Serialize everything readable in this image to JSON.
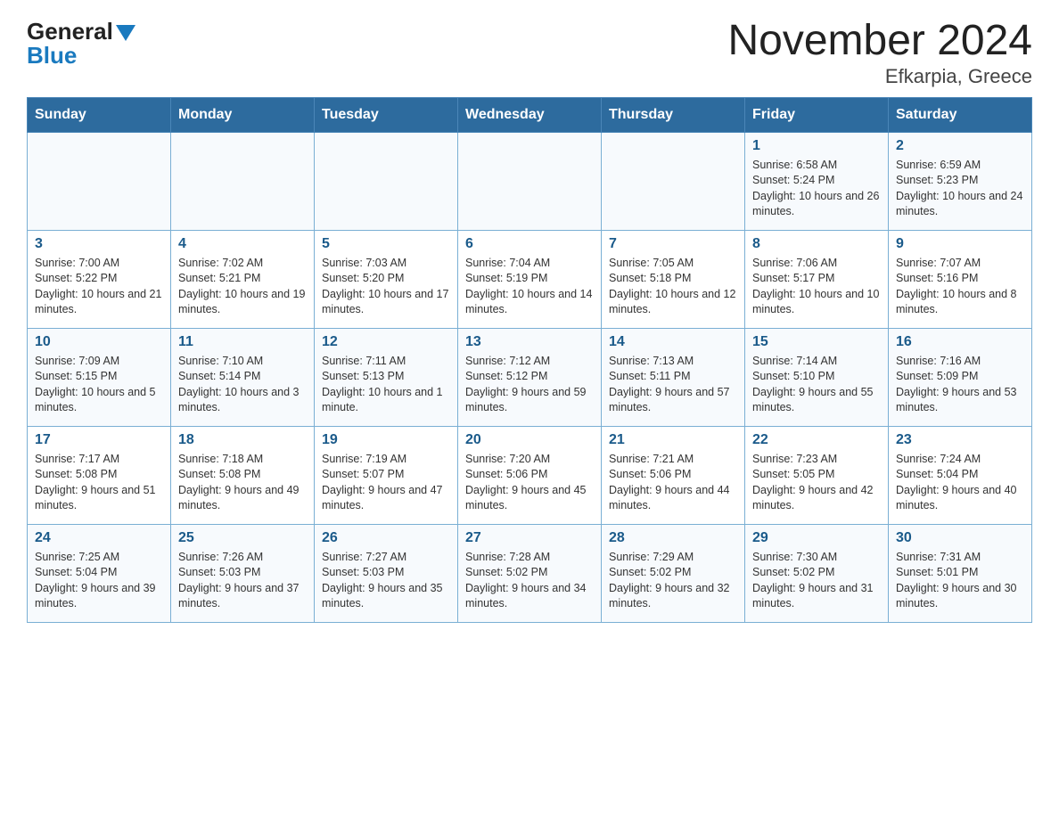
{
  "header": {
    "logo_line1": "General",
    "logo_line2": "Blue",
    "title": "November 2024",
    "subtitle": "Efkarpia, Greece"
  },
  "days": [
    "Sunday",
    "Monday",
    "Tuesday",
    "Wednesday",
    "Thursday",
    "Friday",
    "Saturday"
  ],
  "rows": [
    [
      {
        "day": "",
        "sunrise": "",
        "sunset": "",
        "daylight": ""
      },
      {
        "day": "",
        "sunrise": "",
        "sunset": "",
        "daylight": ""
      },
      {
        "day": "",
        "sunrise": "",
        "sunset": "",
        "daylight": ""
      },
      {
        "day": "",
        "sunrise": "",
        "sunset": "",
        "daylight": ""
      },
      {
        "day": "",
        "sunrise": "",
        "sunset": "",
        "daylight": ""
      },
      {
        "day": "1",
        "sunrise": "Sunrise: 6:58 AM",
        "sunset": "Sunset: 5:24 PM",
        "daylight": "Daylight: 10 hours and 26 minutes."
      },
      {
        "day": "2",
        "sunrise": "Sunrise: 6:59 AM",
        "sunset": "Sunset: 5:23 PM",
        "daylight": "Daylight: 10 hours and 24 minutes."
      }
    ],
    [
      {
        "day": "3",
        "sunrise": "Sunrise: 7:00 AM",
        "sunset": "Sunset: 5:22 PM",
        "daylight": "Daylight: 10 hours and 21 minutes."
      },
      {
        "day": "4",
        "sunrise": "Sunrise: 7:02 AM",
        "sunset": "Sunset: 5:21 PM",
        "daylight": "Daylight: 10 hours and 19 minutes."
      },
      {
        "day": "5",
        "sunrise": "Sunrise: 7:03 AM",
        "sunset": "Sunset: 5:20 PM",
        "daylight": "Daylight: 10 hours and 17 minutes."
      },
      {
        "day": "6",
        "sunrise": "Sunrise: 7:04 AM",
        "sunset": "Sunset: 5:19 PM",
        "daylight": "Daylight: 10 hours and 14 minutes."
      },
      {
        "day": "7",
        "sunrise": "Sunrise: 7:05 AM",
        "sunset": "Sunset: 5:18 PM",
        "daylight": "Daylight: 10 hours and 12 minutes."
      },
      {
        "day": "8",
        "sunrise": "Sunrise: 7:06 AM",
        "sunset": "Sunset: 5:17 PM",
        "daylight": "Daylight: 10 hours and 10 minutes."
      },
      {
        "day": "9",
        "sunrise": "Sunrise: 7:07 AM",
        "sunset": "Sunset: 5:16 PM",
        "daylight": "Daylight: 10 hours and 8 minutes."
      }
    ],
    [
      {
        "day": "10",
        "sunrise": "Sunrise: 7:09 AM",
        "sunset": "Sunset: 5:15 PM",
        "daylight": "Daylight: 10 hours and 5 minutes."
      },
      {
        "day": "11",
        "sunrise": "Sunrise: 7:10 AM",
        "sunset": "Sunset: 5:14 PM",
        "daylight": "Daylight: 10 hours and 3 minutes."
      },
      {
        "day": "12",
        "sunrise": "Sunrise: 7:11 AM",
        "sunset": "Sunset: 5:13 PM",
        "daylight": "Daylight: 10 hours and 1 minute."
      },
      {
        "day": "13",
        "sunrise": "Sunrise: 7:12 AM",
        "sunset": "Sunset: 5:12 PM",
        "daylight": "Daylight: 9 hours and 59 minutes."
      },
      {
        "day": "14",
        "sunrise": "Sunrise: 7:13 AM",
        "sunset": "Sunset: 5:11 PM",
        "daylight": "Daylight: 9 hours and 57 minutes."
      },
      {
        "day": "15",
        "sunrise": "Sunrise: 7:14 AM",
        "sunset": "Sunset: 5:10 PM",
        "daylight": "Daylight: 9 hours and 55 minutes."
      },
      {
        "day": "16",
        "sunrise": "Sunrise: 7:16 AM",
        "sunset": "Sunset: 5:09 PM",
        "daylight": "Daylight: 9 hours and 53 minutes."
      }
    ],
    [
      {
        "day": "17",
        "sunrise": "Sunrise: 7:17 AM",
        "sunset": "Sunset: 5:08 PM",
        "daylight": "Daylight: 9 hours and 51 minutes."
      },
      {
        "day": "18",
        "sunrise": "Sunrise: 7:18 AM",
        "sunset": "Sunset: 5:08 PM",
        "daylight": "Daylight: 9 hours and 49 minutes."
      },
      {
        "day": "19",
        "sunrise": "Sunrise: 7:19 AM",
        "sunset": "Sunset: 5:07 PM",
        "daylight": "Daylight: 9 hours and 47 minutes."
      },
      {
        "day": "20",
        "sunrise": "Sunrise: 7:20 AM",
        "sunset": "Sunset: 5:06 PM",
        "daylight": "Daylight: 9 hours and 45 minutes."
      },
      {
        "day": "21",
        "sunrise": "Sunrise: 7:21 AM",
        "sunset": "Sunset: 5:06 PM",
        "daylight": "Daylight: 9 hours and 44 minutes."
      },
      {
        "day": "22",
        "sunrise": "Sunrise: 7:23 AM",
        "sunset": "Sunset: 5:05 PM",
        "daylight": "Daylight: 9 hours and 42 minutes."
      },
      {
        "day": "23",
        "sunrise": "Sunrise: 7:24 AM",
        "sunset": "Sunset: 5:04 PM",
        "daylight": "Daylight: 9 hours and 40 minutes."
      }
    ],
    [
      {
        "day": "24",
        "sunrise": "Sunrise: 7:25 AM",
        "sunset": "Sunset: 5:04 PM",
        "daylight": "Daylight: 9 hours and 39 minutes."
      },
      {
        "day": "25",
        "sunrise": "Sunrise: 7:26 AM",
        "sunset": "Sunset: 5:03 PM",
        "daylight": "Daylight: 9 hours and 37 minutes."
      },
      {
        "day": "26",
        "sunrise": "Sunrise: 7:27 AM",
        "sunset": "Sunset: 5:03 PM",
        "daylight": "Daylight: 9 hours and 35 minutes."
      },
      {
        "day": "27",
        "sunrise": "Sunrise: 7:28 AM",
        "sunset": "Sunset: 5:02 PM",
        "daylight": "Daylight: 9 hours and 34 minutes."
      },
      {
        "day": "28",
        "sunrise": "Sunrise: 7:29 AM",
        "sunset": "Sunset: 5:02 PM",
        "daylight": "Daylight: 9 hours and 32 minutes."
      },
      {
        "day": "29",
        "sunrise": "Sunrise: 7:30 AM",
        "sunset": "Sunset: 5:02 PM",
        "daylight": "Daylight: 9 hours and 31 minutes."
      },
      {
        "day": "30",
        "sunrise": "Sunrise: 7:31 AM",
        "sunset": "Sunset: 5:01 PM",
        "daylight": "Daylight: 9 hours and 30 minutes."
      }
    ]
  ]
}
